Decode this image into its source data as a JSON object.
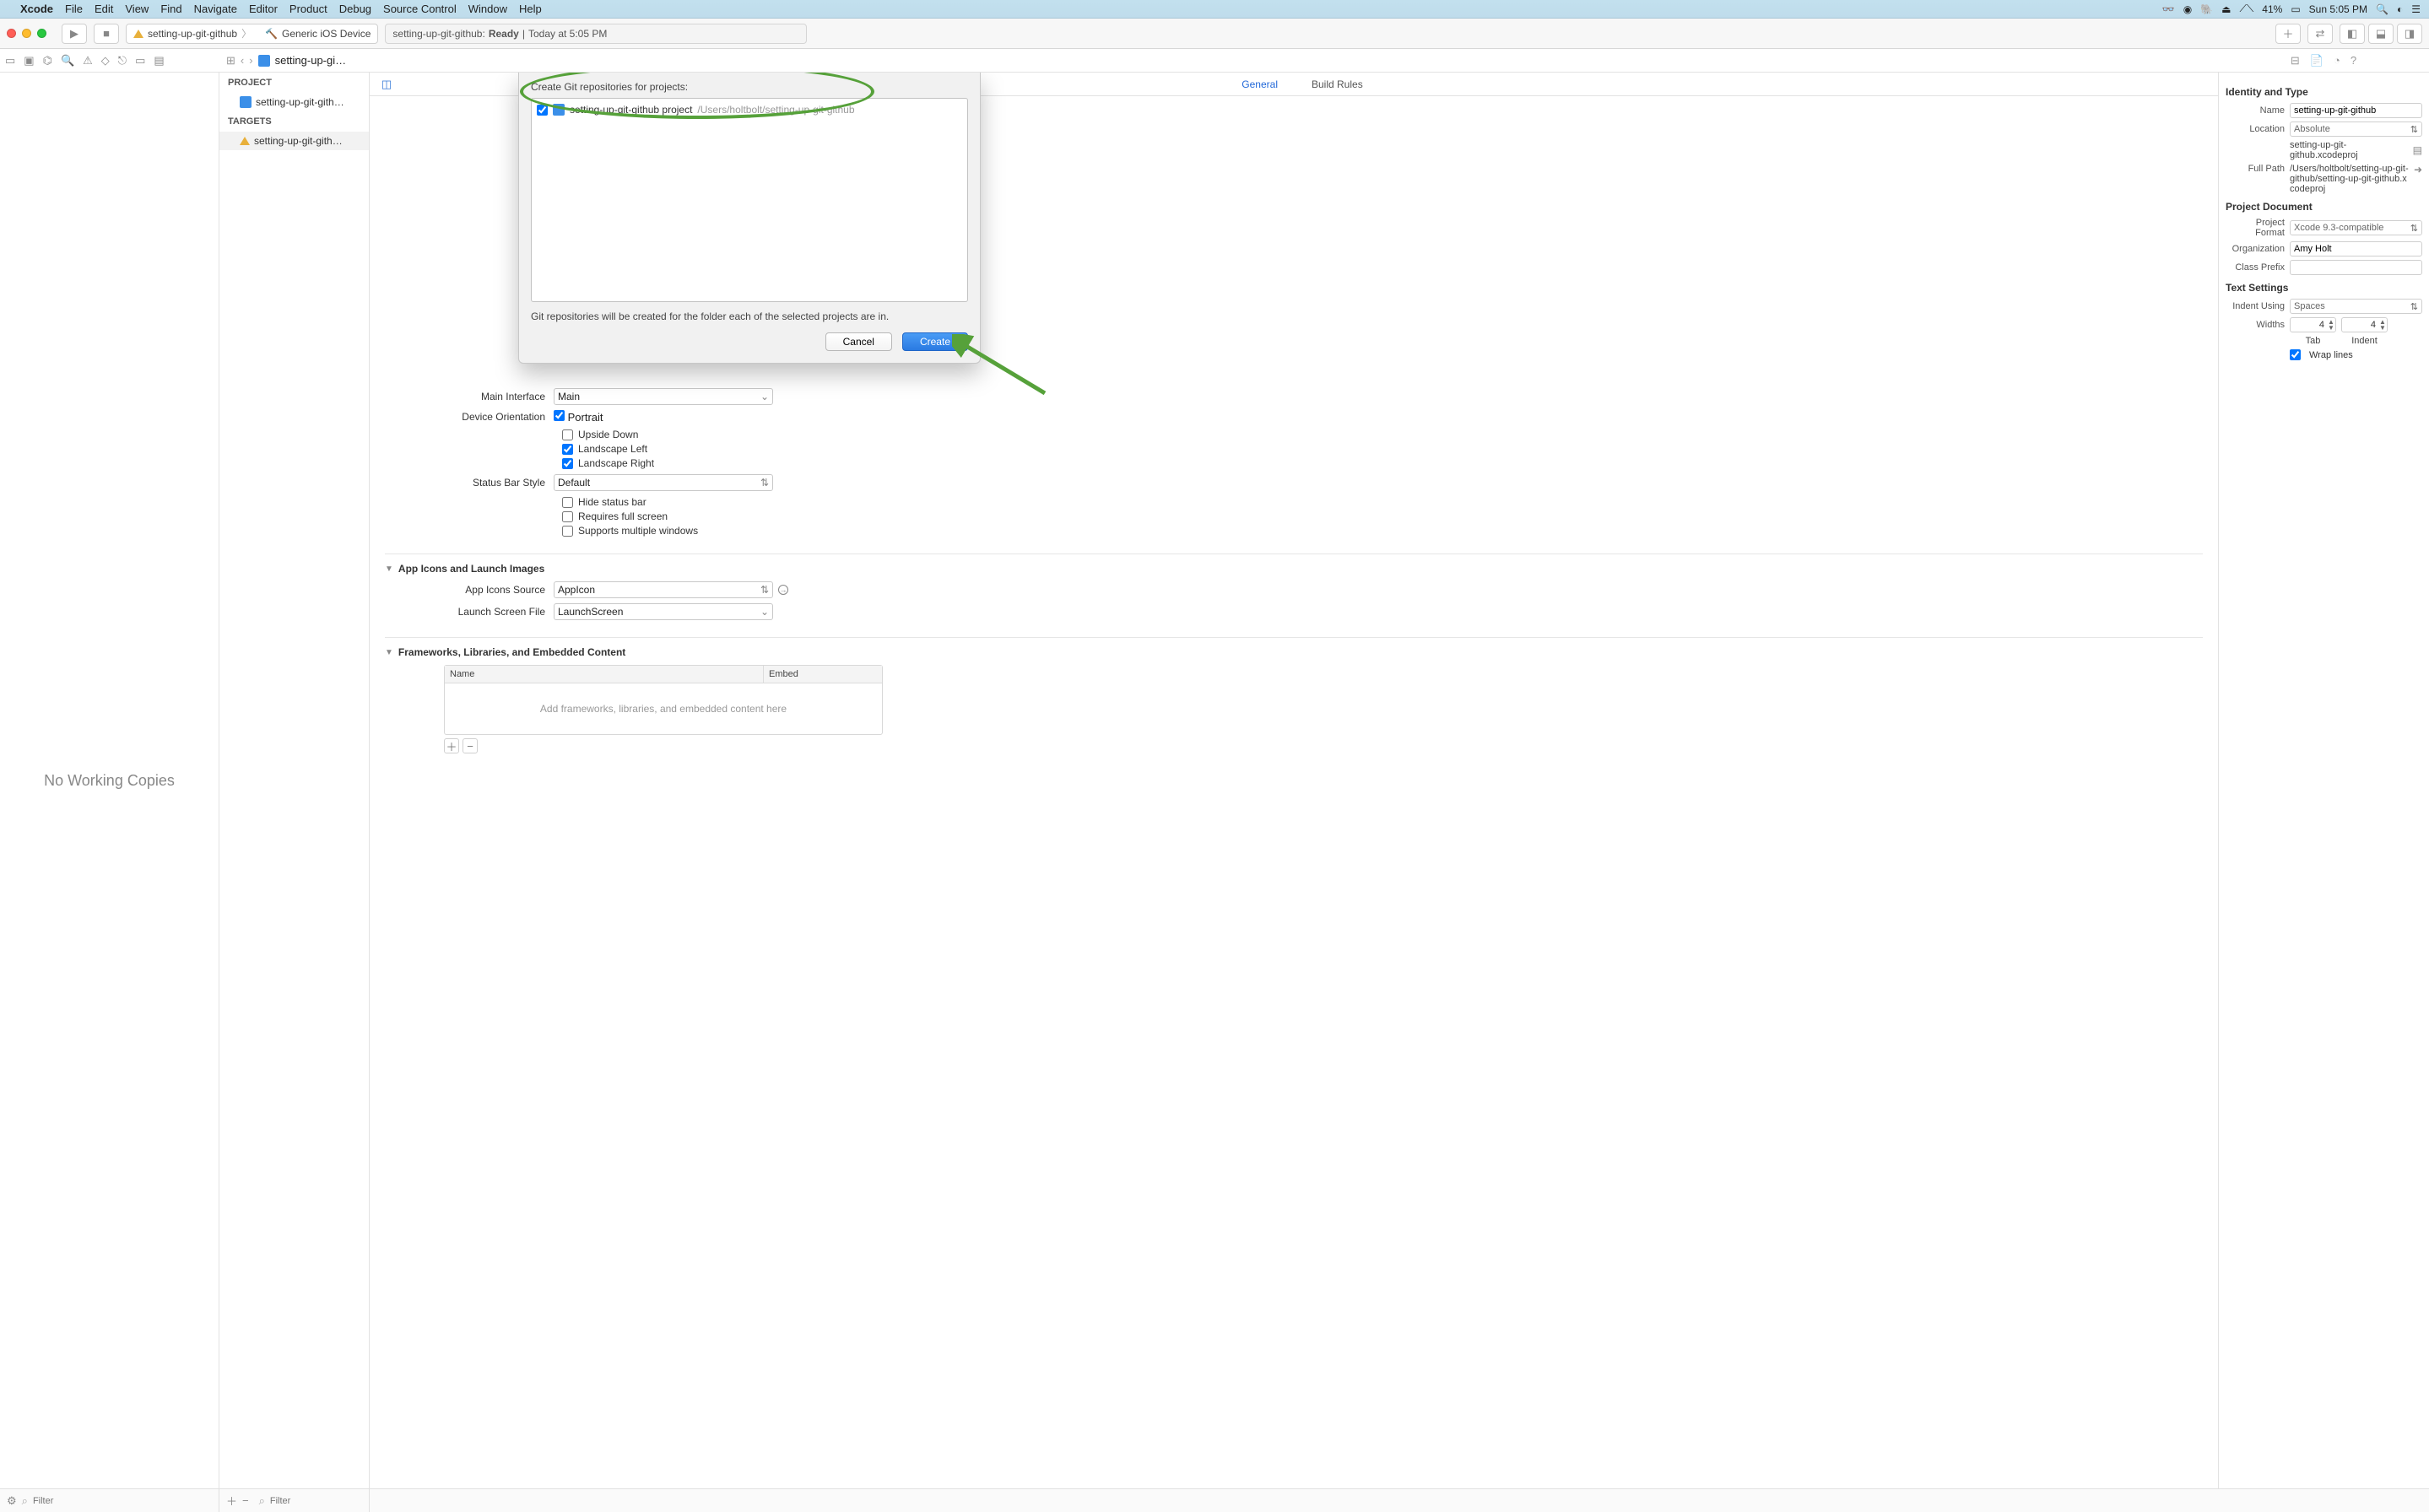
{
  "menubar": {
    "app": "Xcode",
    "items": [
      "File",
      "Edit",
      "View",
      "Find",
      "Navigate",
      "Editor",
      "Product",
      "Debug",
      "Source Control",
      "Window",
      "Help"
    ],
    "battery": "41%",
    "clock": "Sun 5:05 PM"
  },
  "toolbar": {
    "scheme_project": "setting-up-git-github",
    "scheme_device": "Generic iOS Device",
    "status_project": "setting-up-git-github:",
    "status_state": "Ready",
    "status_sep": "|",
    "status_time": "Today at 5:05 PM"
  },
  "tabbar": {
    "file": "setting-up-gi…"
  },
  "left_panel": {
    "placeholder": "No Working Copies"
  },
  "navigator": {
    "project_header": "PROJECT",
    "project_item": "setting-up-git-gith…",
    "targets_header": "TARGETS",
    "target_item": "setting-up-git-gith…"
  },
  "editor": {
    "tabs": [
      "General",
      "Build Rules"
    ],
    "main_interface_label": "Main Interface",
    "main_interface_value": "Main",
    "orientation_label": "Device Orientation",
    "orientation_opts": {
      "portrait": "Portrait",
      "upside": "Upside Down",
      "lleft": "Landscape Left",
      "lright": "Landscape Right"
    },
    "statusbar_label": "Status Bar Style",
    "statusbar_value": "Default",
    "hide_status": "Hide status bar",
    "req_full": "Requires full screen",
    "multi_win": "Supports multiple windows",
    "section_icons": "App Icons and Launch Images",
    "appicons_label": "App Icons Source",
    "appicons_value": "AppIcon",
    "launch_label": "Launch Screen File",
    "launch_value": "LaunchScreen",
    "section_frameworks": "Frameworks, Libraries, and Embedded Content",
    "table_col1": "Name",
    "table_col2": "Embed",
    "table_empty": "Add frameworks, libraries, and embedded content here"
  },
  "inspector": {
    "identity_title": "Identity and Type",
    "name_label": "Name",
    "name_value": "setting-up-git-github",
    "location_label": "Location",
    "location_value": "Absolute",
    "location_file": "setting-up-git-github.xcodeproj",
    "fullpath_label": "Full Path",
    "fullpath_value": "/Users/holtbolt/setting-up-git-github/setting-up-git-github.xcodeproj",
    "projdoc_title": "Project Document",
    "format_label": "Project Format",
    "format_value": "Xcode 9.3-compatible",
    "org_label": "Organization",
    "org_value": "Amy Holt",
    "prefix_label": "Class Prefix",
    "prefix_value": "",
    "text_title": "Text Settings",
    "indent_label": "Indent Using",
    "indent_value": "Spaces",
    "widths_label": "Widths",
    "tab_val": "4",
    "indent_val": "4",
    "tab_caption": "Tab",
    "indent_caption": "Indent",
    "wrap_label": "Wrap lines"
  },
  "sheet": {
    "title": "Create Git repositories for projects:",
    "project_name": "setting-up-git-github project",
    "project_path": "/Users/holtbolt/setting-up-git-github",
    "note": "Git repositories will be created for the folder each of the selected projects are in.",
    "cancel": "Cancel",
    "create": "Create"
  },
  "bottombar": {
    "filter_placeholder": "Filter"
  }
}
